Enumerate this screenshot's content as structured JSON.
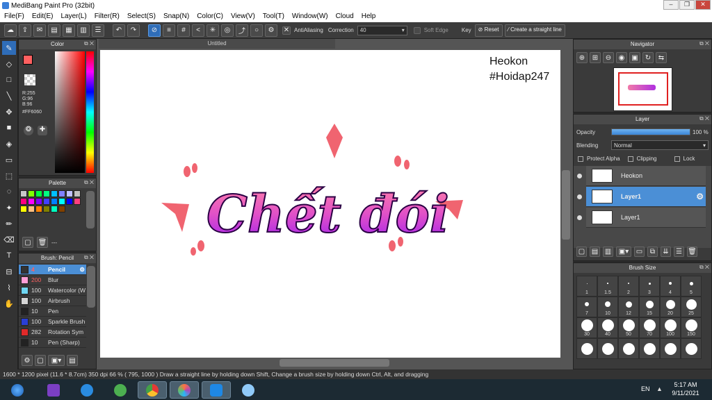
{
  "window": {
    "title": "MediBang Paint Pro (32bit)"
  },
  "menu": [
    "File(F)",
    "Edit(E)",
    "Layer(L)",
    "Filter(R)",
    "Select(S)",
    "Snap(N)",
    "Color(C)",
    "View(V)",
    "Tool(T)",
    "Window(W)",
    "Cloud",
    "Help"
  ],
  "toolbar": {
    "antialias_label": "AntiAliasing",
    "correction_label": "Correction",
    "correction_value": "40",
    "soft_edge_label": "Soft Edge",
    "key_label": "Key",
    "reset_label": "Reset",
    "straight_line_label": "Create a straight line"
  },
  "color_panel": {
    "title": "Color",
    "primary": "#FF6060",
    "r": "R:255",
    "g": "G:96",
    "b": "B:96",
    "hex": "#FF6060"
  },
  "palette_panel": {
    "title": "Palette",
    "new_label": "---",
    "colors": [
      "#c8c8c8",
      "#80ff00",
      "#00ff40",
      "#00ff80",
      "#00c0ff",
      "#8080ff",
      "#c0c0ff",
      "#c0c0c0",
      "#ff0080",
      "#ff00ff",
      "#8000ff",
      "#4040ff",
      "#0080ff",
      "#00ffff",
      "#0000ff",
      "#ff4080",
      "#ffff00",
      "#ffc080",
      "#ff8000",
      "#808000",
      "#00ffc0",
      "#804000"
    ]
  },
  "brush_panel": {
    "title": "Brush: Pencil",
    "brushes": [
      {
        "size": "4",
        "name": "Pencil",
        "color": "#333333"
      },
      {
        "size": "200",
        "name": "Blur",
        "color": "#ff9ed6"
      },
      {
        "size": "100",
        "name": "Watercolor (W",
        "color": "#6fd6f2"
      },
      {
        "size": "100",
        "name": "Airbrush",
        "color": "#d6d6d6"
      },
      {
        "size": "10",
        "name": "Pen",
        "color": "#222222"
      },
      {
        "size": "100",
        "name": "Sparkle Brush",
        "color": "#2a3fd6"
      },
      {
        "size": "282",
        "name": "Rotation Sym",
        "color": "#e02a2a"
      },
      {
        "size": "10",
        "name": "Pen (Sharp)",
        "color": "#222222"
      }
    ]
  },
  "document": {
    "tab": "Untitled",
    "watermark_line1": "Heokon",
    "watermark_line2": "#Hoidap247",
    "art_text": "Chết đói"
  },
  "navigator": {
    "title": "Navigator"
  },
  "layer_panel": {
    "title": "Layer",
    "opacity_label": "Opacity",
    "opacity_value": "100 %",
    "opacity_fraction": 1.0,
    "blending_label": "Blending",
    "blending_value": "Normal",
    "protect_alpha": "Protect Alpha",
    "clipping": "Clipping",
    "lock": "Lock",
    "layers": [
      "Heokon",
      "Layer1",
      "Layer1"
    ]
  },
  "brush_size": {
    "title": "Brush Size",
    "sizes": [
      "1",
      "1.5",
      "2",
      "3",
      "4",
      "5",
      "7",
      "10",
      "12",
      "15",
      "20",
      "25",
      "30",
      "40",
      "50",
      "70",
      "100",
      "150",
      "",
      "",
      "",
      "",
      "",
      ""
    ]
  },
  "status": "1600 * 1200 pixel   (11.6 * 8.7cm)   350 dpi   66 %   ( 795, 1000 )   Draw a straight line by holding down Shift, Change a brush size by holding down Ctrl, Alt, and dragging",
  "taskbar": {
    "lang": "EN",
    "time": "5:17 AM",
    "date": "9/11/2021"
  }
}
